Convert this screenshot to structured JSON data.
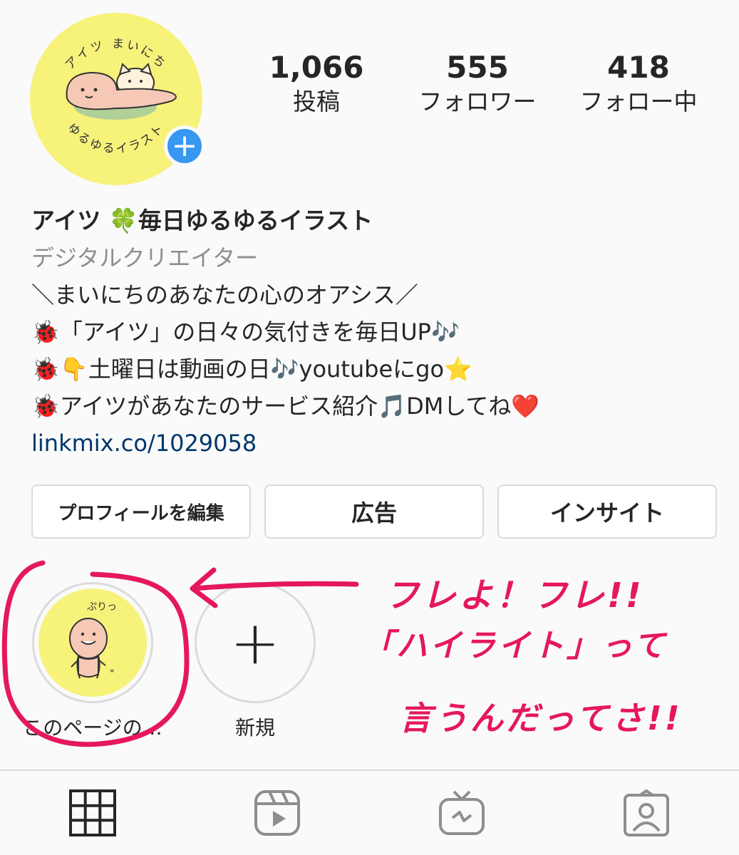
{
  "profile": {
    "avatar_icon": "avatar-illustration",
    "avatar_text_top": "アイツ まいにち",
    "avatar_text_bottom": "ゆるゆるイラスト",
    "add_icon": "plus-icon",
    "add_symbol": "+"
  },
  "stats": [
    {
      "value": "1,066",
      "label": "投稿"
    },
    {
      "value": "555",
      "label": "フォロワー"
    },
    {
      "value": "418",
      "label": "フォロー中"
    }
  ],
  "bio": {
    "name": "アイツ 🍀毎日ゆるゆるイラスト",
    "category": "デジタルクリエイター",
    "lines": [
      "＼まいにちのあなたの心のオアシス／",
      "🐞「アイツ」の日々の気付きを毎日UP🎶",
      "🐞👇土曜日は動画の日🎶youtubeにgo⭐",
      "🐞アイツがあなたのサービス紹介🎵DMしてね❤️"
    ],
    "link": "linkmix.co/1029058"
  },
  "buttons": {
    "edit_profile": "プロフィールを編集",
    "ads": "広告",
    "insights": "インサイト"
  },
  "highlights": [
    {
      "label": "このページの…",
      "icon": "highlight-cover-illustration",
      "cover_text": "ぷりっ"
    },
    {
      "label": "新規",
      "icon": "plus-icon",
      "symbol": "+"
    }
  ],
  "annotation": {
    "line1": "フレよ！フレ!!",
    "line2": "「ハイライト」って",
    "line3": "言うんだってさ!!",
    "color": "#e5185b"
  },
  "bottom_nav": [
    {
      "icon": "grid-icon",
      "active": true
    },
    {
      "icon": "reels-icon",
      "active": false
    },
    {
      "icon": "igtv-icon",
      "active": false
    },
    {
      "icon": "tagged-icon",
      "active": false
    }
  ],
  "colors": {
    "background": "#fafafa",
    "text": "#262626",
    "muted": "#8e8e8e",
    "link": "#00376b",
    "badge": "#3897f0",
    "avatar_bg": "#f7f27a",
    "border": "#dbdbdb",
    "annotation": "#e5185b"
  }
}
